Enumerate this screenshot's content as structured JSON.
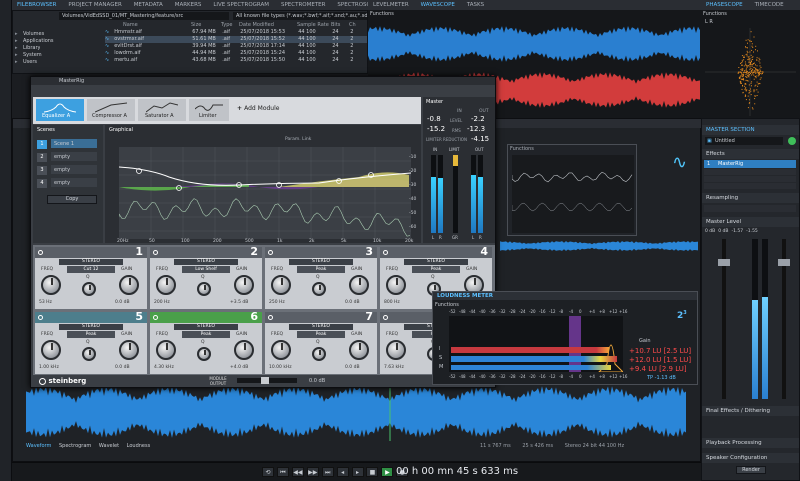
{
  "top_tabs": [
    "FILEBROWSER",
    "PROJECT MANAGER",
    "METADATA",
    "MARKERS",
    "LIVE SPECTROGRAM",
    "SPECTROMETER",
    "SPECTROSCOPE"
  ],
  "mid_tabs": [
    "LEVELMETER",
    "WAVESCOPE",
    "TASKS"
  ],
  "right_tabs": [
    "PHASESCOPE",
    "TIMECODE"
  ],
  "file_path": "Volumes/VidEdSSD_01/MT_Mastering/feature/src",
  "file_filter": "All known file types (*.wav;*.bwf;*.aif;*.snd;*.au;*.sd;*.aiaw",
  "file_columns": [
    "Name",
    "Size",
    "Type",
    "Date Modified",
    "Sample Rate",
    "Bits",
    "Ch"
  ],
  "files": [
    {
      "name": "Hrnmstr.aif",
      "size": "67.94 MB",
      "type": ".aif",
      "date": "25/07/2018 15:53",
      "rate": "44 100",
      "bits": "24",
      "ch": "2"
    },
    {
      "name": "ovstrmxr.aif",
      "size": "51.61 MB",
      "type": ".aif",
      "date": "25/07/2018 15:52",
      "rate": "44 100",
      "bits": "24",
      "ch": "2"
    },
    {
      "name": "evltDrst.aif",
      "size": "39.94 MB",
      "type": ".aif",
      "date": "25/07/2018 17:14",
      "rate": "44 100",
      "bits": "24",
      "ch": "2"
    },
    {
      "name": "lowdrm.aif",
      "size": "44.94 MB",
      "type": ".aif",
      "date": "25/07/2018 15:24",
      "rate": "44 100",
      "bits": "24",
      "ch": "2"
    },
    {
      "name": "mertu.aif",
      "size": "43.68 MB",
      "type": ".aif",
      "date": "25/07/2018 15:50",
      "rate": "44 100",
      "bits": "24",
      "ch": "2"
    }
  ],
  "tree": [
    "Volumes",
    "Applications",
    "Library",
    "System",
    "Users"
  ],
  "plugin": {
    "title": "MasterRig",
    "modules": [
      "Equalizer A",
      "Compressor A",
      "Saturator A",
      "Limiter"
    ],
    "add_module": "Add Module",
    "scenes_title": "Scenes",
    "graphical_title": "Graphical",
    "params_link": "Param. Link",
    "scenes": [
      {
        "n": "1",
        "label": "Scene 1"
      },
      {
        "n": "2",
        "label": "empty"
      },
      {
        "n": "3",
        "label": "empty"
      },
      {
        "n": "4",
        "label": "empty"
      }
    ],
    "copy": "Copy",
    "freq_labels": [
      "20Hz",
      "50",
      "100",
      "200",
      "500",
      "1k",
      "2k",
      "5k",
      "10k",
      "20k"
    ],
    "db_labels": [
      "-10",
      "-20",
      "-30",
      "-40",
      "-50",
      "-60"
    ],
    "master_title": "Master",
    "master_in": "IN",
    "master_out": "OUT",
    "peak_l_in": "-0.8",
    "peak_l_out": "-2.2",
    "level_label": "LEVEL",
    "rms_label": "RMS",
    "rms_in": "-15.2",
    "rms_out": "-12.3",
    "limiter_reduction": "LIMITER REDUCTION",
    "reduction_val": "-4.15",
    "meter_labels": [
      "L",
      "R",
      "GR",
      "L",
      "R"
    ],
    "meter_top": [
      "IN",
      "LIMIT",
      "OUT"
    ],
    "bands": [
      {
        "n": "1",
        "mode": "STEREO",
        "type": "Cut 12",
        "freq": "53 Hz",
        "gain": "0.0 dB"
      },
      {
        "n": "2",
        "mode": "STEREO",
        "type": "Low Shelf",
        "freq": "200 Hz",
        "gain": "+3.5 dB"
      },
      {
        "n": "3",
        "mode": "STEREO",
        "type": "Peak",
        "freq": "250 Hz",
        "gain": "0.0 dB"
      },
      {
        "n": "4",
        "mode": "STEREO",
        "type": "Peak",
        "freq": "800 Hz",
        "gain": "-1.0 dB"
      },
      {
        "n": "5",
        "mode": "STEREO",
        "type": "Peak",
        "freq": "1.00 kHz",
        "gain": "0.0 dB"
      },
      {
        "n": "6",
        "mode": "STEREO",
        "type": "Peak",
        "freq": "4.30 kHz",
        "gain": "+4.0 dB"
      },
      {
        "n": "7",
        "mode": "STEREO",
        "type": "Peak",
        "freq": "10.00 kHz",
        "gain": "0.0 dB"
      },
      {
        "n": "8",
        "mode": "STEREO",
        "type": "High",
        "freq": "7.63 kHz",
        "gain": "0.0 dB"
      }
    ],
    "freq_word": "FREQ",
    "gain_word": "GAIN",
    "q_word": "Q",
    "brand": "steinberg",
    "module_output": "MODULE OUTPUT",
    "out_val": "0.0 dB"
  },
  "loudness": {
    "title": "LOUDNESS METER",
    "functions": "Functions",
    "scale": [
      "-52",
      "-48",
      "-44",
      "-40",
      "-36",
      "-32",
      "-28",
      "-24",
      "-20",
      "-16",
      "-12",
      "-8",
      "-4",
      "0",
      "+4",
      "+8",
      "+12",
      "+16"
    ],
    "gain_label": "Gain",
    "rows": [
      {
        "key": "I",
        "value": "+10.7 LU",
        "sub": "[2.5 LU]"
      },
      {
        "key": "S",
        "value": "+12.0 LU",
        "sub": "[1.5 LU]"
      },
      {
        "key": "M",
        "value": "+9.4 LU",
        "sub": "[2.9 LU]"
      }
    ],
    "tp": "TP",
    "tp_val": "-1.13 dB"
  },
  "master_section": {
    "title": "MASTER SECTION",
    "preset": "Untitled",
    "effects": "Effects",
    "slot": "MasterRig",
    "resampling": "Resampling",
    "master_level": "Master Level",
    "levels": [
      "0 dB",
      "0 dB",
      "-1.57",
      "-1.55"
    ],
    "final": "Final Effects / Dithering",
    "playback": "Playback Processing",
    "speaker": "Speaker Configuration",
    "render": "Render"
  },
  "wave_tabs": [
    "Waveform",
    "Spectrogram",
    "Wavelet",
    "Loudness"
  ],
  "time_display": "00 h 00 mn 45 s 633 ms",
  "status": [
    "11 s 767 ms",
    "25 s 426 ms",
    "Stereo 24 bit 44 100 Hz"
  ],
  "functions_label": "Functions",
  "phasescope_label": "L R",
  "colors": {
    "accent": "#3aa8e8",
    "wave_blue": "#2a7fd0",
    "wave_red": "#d23c3c",
    "eq_green": "#5cb04a"
  }
}
